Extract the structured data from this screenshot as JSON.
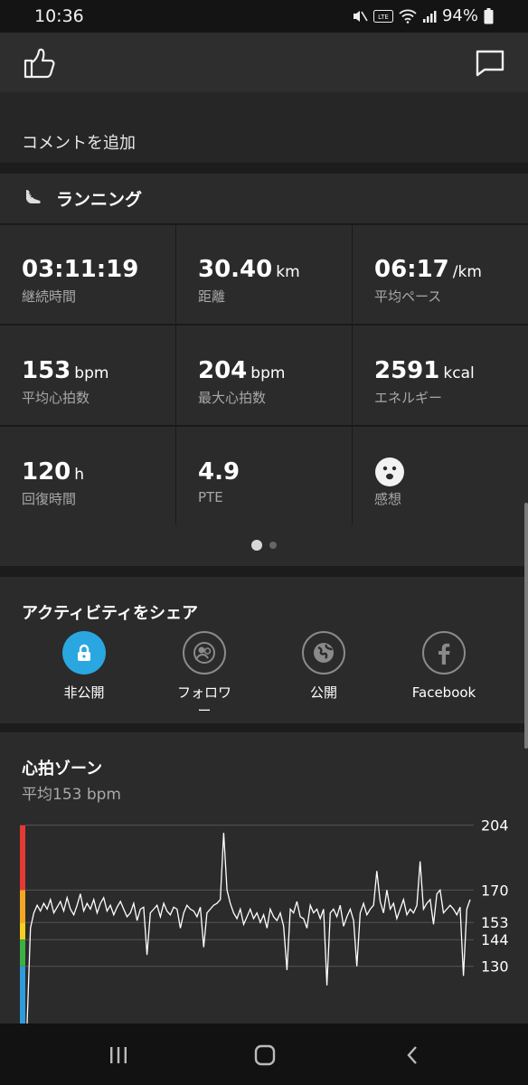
{
  "status_bar": {
    "time": "10:36",
    "battery": "94%",
    "icons": [
      "mute-icon",
      "volte-icon",
      "wifi-icon",
      "signal-icon",
      "battery-icon"
    ]
  },
  "actions": {
    "like_icon": "thumbs-up-icon",
    "comment_icon": "speech-bubble-icon"
  },
  "comment": {
    "placeholder": "コメントを追加"
  },
  "activity": {
    "title": "ランニング",
    "icon": "running-shoe-icon",
    "stats": [
      {
        "value": "03:11:19",
        "unit": "",
        "label": "継続時間"
      },
      {
        "value": "30.40",
        "unit": "km",
        "label": "距離"
      },
      {
        "value": "06:17",
        "unit": "/km",
        "label": "平均ペース"
      },
      {
        "value": "153",
        "unit": "bpm",
        "label": "平均心拍数"
      },
      {
        "value": "204",
        "unit": "bpm",
        "label": "最大心拍数"
      },
      {
        "value": "2591",
        "unit": "kcal",
        "label": "エネルギー"
      },
      {
        "value": "120",
        "unit": "h",
        "label": "回復時間"
      },
      {
        "value": "4.9",
        "unit": "",
        "label": "PTE"
      },
      {
        "value": "",
        "unit": "",
        "label": "感想",
        "icon": "smiley-face-icon"
      }
    ],
    "pages": 2,
    "current_page": 1
  },
  "share": {
    "title": "アクティビティをシェア",
    "options": [
      {
        "label": "非公開",
        "icon": "lock-icon",
        "selected": true
      },
      {
        "label": "フォロワー",
        "icon": "followers-icon",
        "selected": false
      },
      {
        "label": "公開",
        "icon": "globe-icon",
        "selected": false
      },
      {
        "label": "Facebook",
        "icon": "facebook-icon",
        "selected": false
      }
    ]
  },
  "heart_rate": {
    "title": "心拍ゾーン",
    "subtitle": "平均153 bpm"
  },
  "chart_data": {
    "type": "line",
    "title": "心拍ゾーン",
    "ylabel": "",
    "y_ticks": [
      204,
      170,
      153,
      144,
      130
    ],
    "ylim": [
      100,
      210
    ],
    "zone_colors": [
      "#e53935",
      "#f5a623",
      "#f5d020",
      "#3cb043",
      "#2e9bdc"
    ],
    "zones": [
      {
        "from": 170,
        "to": 204,
        "color": "#e53935"
      },
      {
        "from": 153,
        "to": 170,
        "color": "#f5a623"
      },
      {
        "from": 144,
        "to": 153,
        "color": "#f5d020"
      },
      {
        "from": 130,
        "to": 144,
        "color": "#3cb043"
      },
      {
        "from": 100,
        "to": 130,
        "color": "#2e9bdc"
      }
    ],
    "series": [
      {
        "values": [
          100,
          150,
          158,
          162,
          159,
          163,
          160,
          165,
          158,
          161,
          164,
          159,
          166,
          160,
          157,
          162,
          168,
          159,
          163,
          160,
          165,
          158,
          163,
          166,
          159,
          162,
          157,
          161,
          164,
          160,
          156,
          158,
          163,
          154,
          160,
          161,
          136,
          158,
          160,
          162,
          156,
          163,
          159,
          157,
          161,
          160,
          150,
          158,
          162,
          160,
          159,
          156,
          161,
          140,
          158,
          160,
          162,
          163,
          165,
          200,
          170,
          163,
          158,
          155,
          160,
          152,
          156,
          160,
          155,
          158,
          153,
          157,
          150,
          160,
          156,
          154,
          158,
          151,
          128,
          160,
          158,
          164,
          156,
          155,
          150,
          162,
          158,
          160,
          155,
          160,
          120,
          158,
          160,
          156,
          162,
          151,
          156,
          160,
          154,
          130,
          158,
          163,
          157,
          160,
          162,
          180,
          164,
          158,
          170,
          160,
          163,
          155,
          160,
          165,
          157,
          160,
          158,
          162,
          185,
          160,
          163,
          165,
          152,
          168,
          170,
          158,
          160,
          162,
          160,
          157,
          161,
          125,
          160,
          165
        ]
      }
    ]
  },
  "nav": {
    "icons": [
      "recent-apps-icon",
      "home-icon",
      "back-icon"
    ]
  }
}
